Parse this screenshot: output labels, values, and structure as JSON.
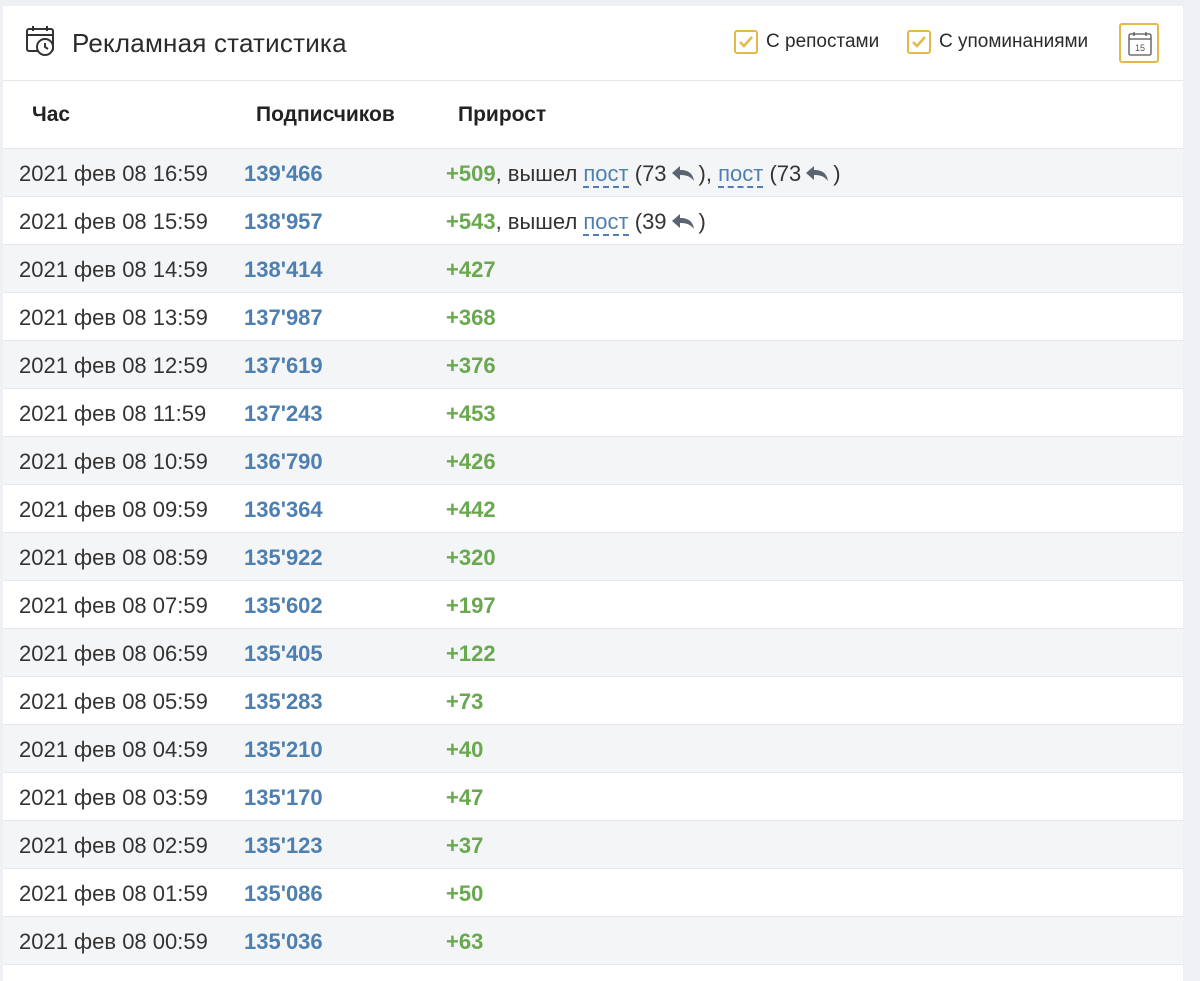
{
  "header": {
    "title": "Рекламная статистика",
    "option_reposts": "С репостами",
    "option_mentions": "С упоминаниями",
    "calendar_day": "15"
  },
  "columns": {
    "hour": "Час",
    "subscribers": "Подписчиков",
    "growth": "Прирост"
  },
  "colors": {
    "accent": "#e4b94a",
    "link": "#4e7fb1",
    "positive": "#6aa84f"
  },
  "rows": [
    {
      "time": "2021 фев 08 16:59",
      "subs": "139'466",
      "growth": "+509",
      "sep1": ", вышел ",
      "post1": "пост",
      "paren1": "(73",
      "close1": "), ",
      "post2": "пост",
      "paren2": "(73",
      "close2": ")"
    },
    {
      "time": "2021 фев 08 15:59",
      "subs": "138'957",
      "growth": "+543",
      "sep1": ", вышел ",
      "post1": "пост",
      "paren1": "(39",
      "close1": ")"
    },
    {
      "time": "2021 фев 08 14:59",
      "subs": "138'414",
      "growth": "+427"
    },
    {
      "time": "2021 фев 08 13:59",
      "subs": "137'987",
      "growth": "+368"
    },
    {
      "time": "2021 фев 08 12:59",
      "subs": "137'619",
      "growth": "+376"
    },
    {
      "time": "2021 фев 08 11:59",
      "subs": "137'243",
      "growth": "+453"
    },
    {
      "time": "2021 фев 08 10:59",
      "subs": "136'790",
      "growth": "+426"
    },
    {
      "time": "2021 фев 08 09:59",
      "subs": "136'364",
      "growth": "+442"
    },
    {
      "time": "2021 фев 08 08:59",
      "subs": "135'922",
      "growth": "+320"
    },
    {
      "time": "2021 фев 08 07:59",
      "subs": "135'602",
      "growth": "+197"
    },
    {
      "time": "2021 фев 08 06:59",
      "subs": "135'405",
      "growth": "+122"
    },
    {
      "time": "2021 фев 08 05:59",
      "subs": "135'283",
      "growth": "+73"
    },
    {
      "time": "2021 фев 08 04:59",
      "subs": "135'210",
      "growth": "+40"
    },
    {
      "time": "2021 фев 08 03:59",
      "subs": "135'170",
      "growth": "+47"
    },
    {
      "time": "2021 фев 08 02:59",
      "subs": "135'123",
      "growth": "+37"
    },
    {
      "time": "2021 фев 08 01:59",
      "subs": "135'086",
      "growth": "+50"
    },
    {
      "time": "2021 фев 08 00:59",
      "subs": "135'036",
      "growth": "+63"
    }
  ]
}
